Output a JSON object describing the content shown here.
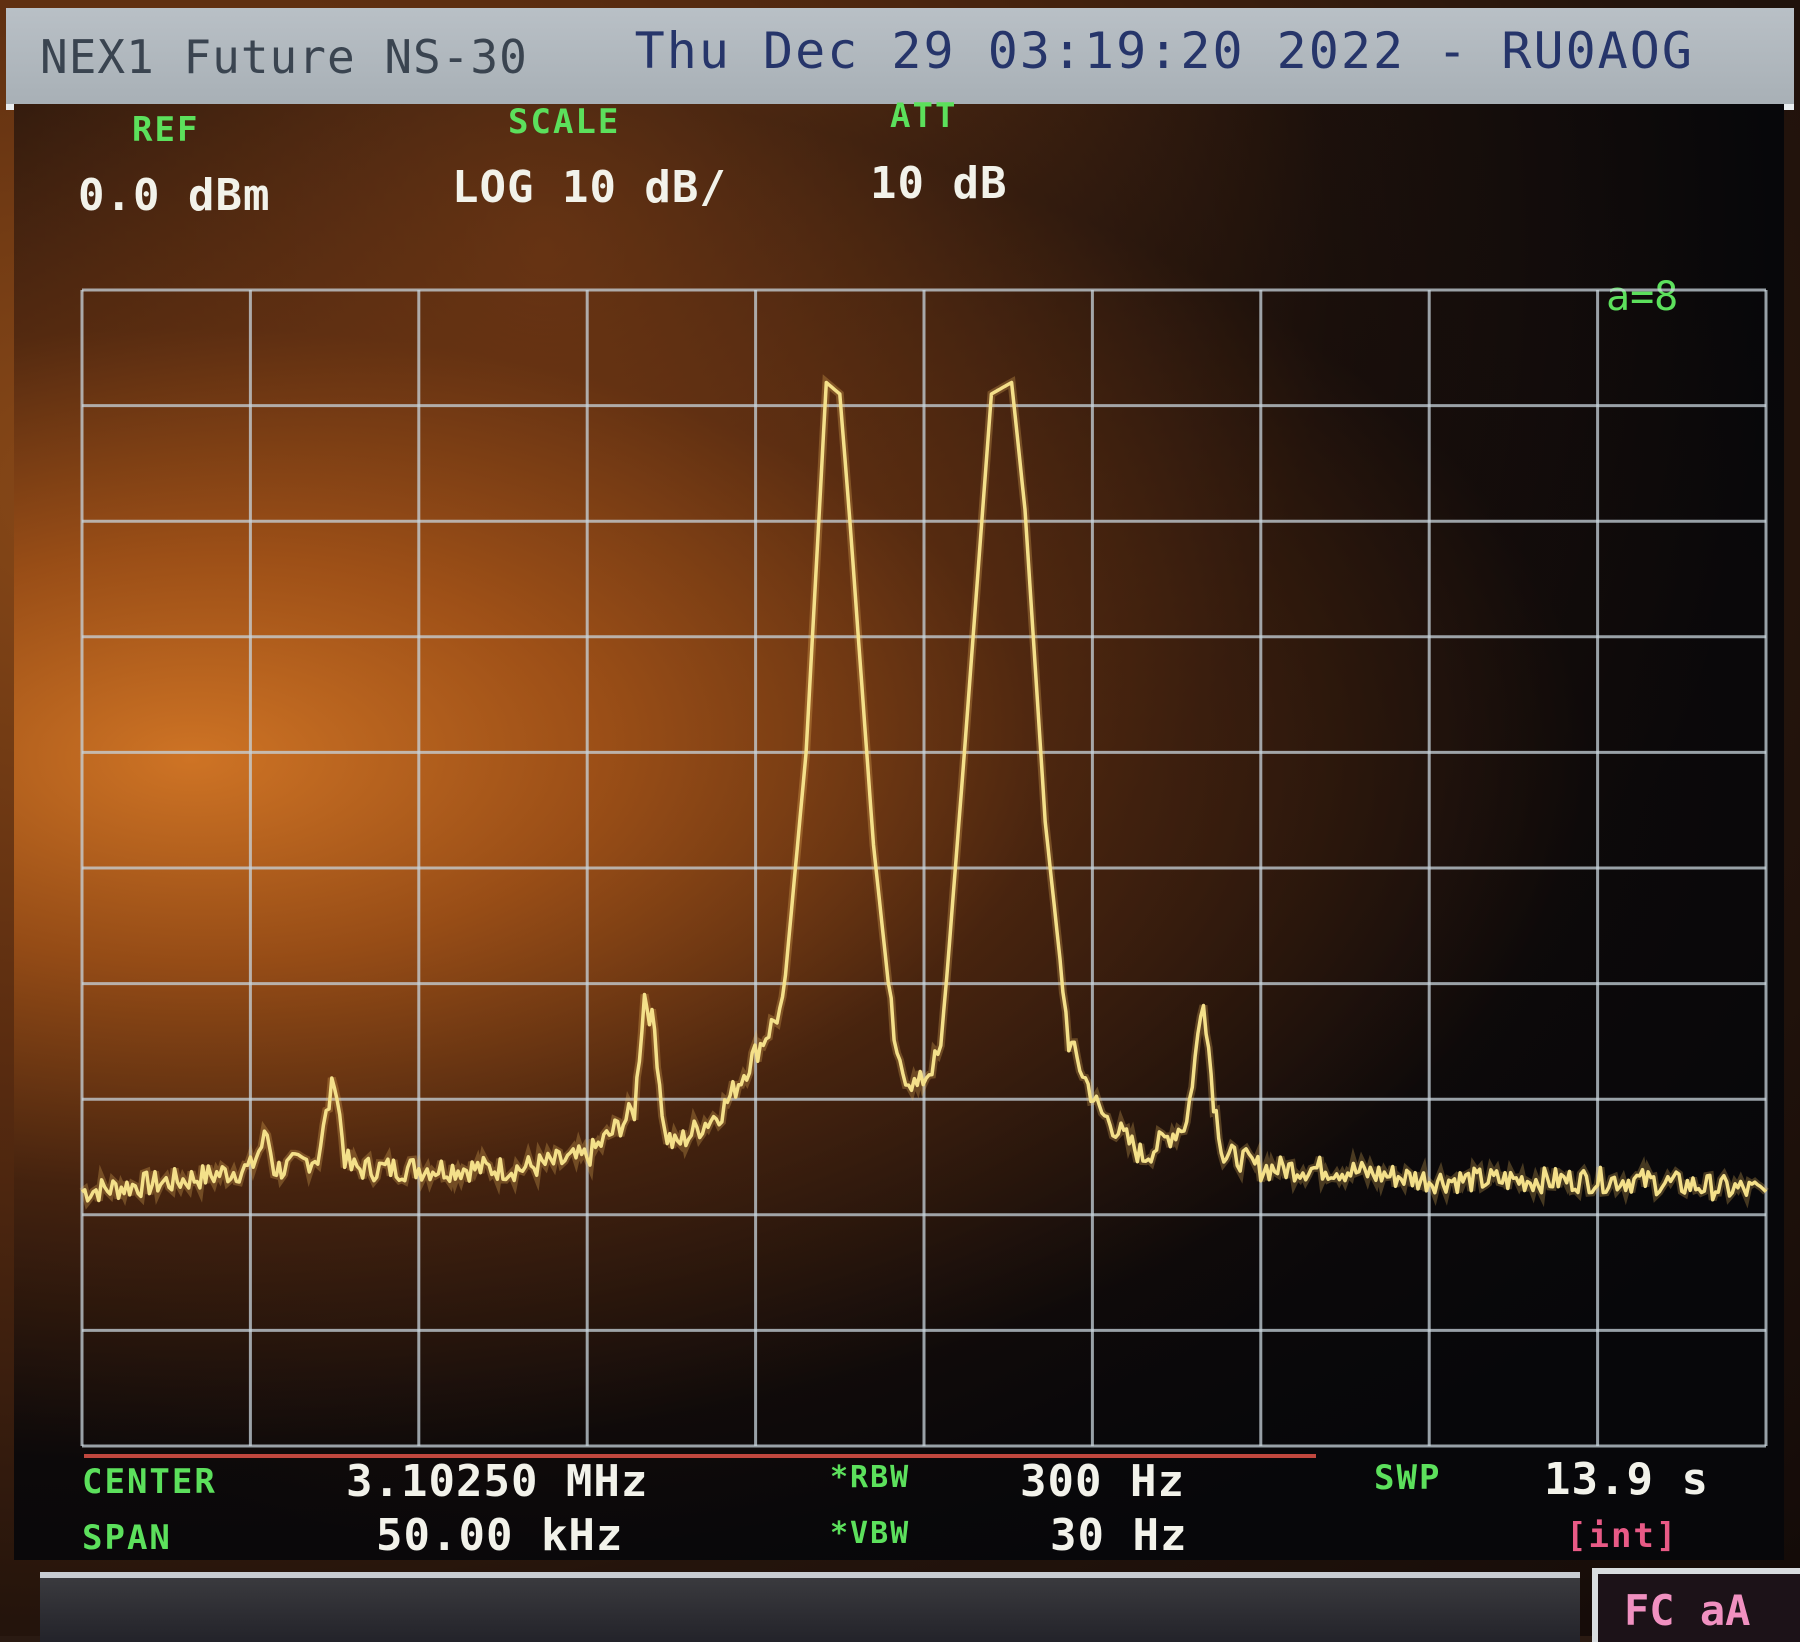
{
  "window": {
    "instrument_title": "NEX1 Future NS-30",
    "status_text": "Thu Dec 29 03:19:20 2022 - RU0AOG"
  },
  "header": {
    "ref_label": "REF",
    "ref_value": "0.0 dBm",
    "scale_label": "SCALE",
    "scale_value": "LOG 10 dB/",
    "att_label": "ATT",
    "att_value": "10 dB"
  },
  "marker": {
    "readout": "a=8"
  },
  "footer": {
    "center_label": "CENTER",
    "center_value": "3.10250 MHz",
    "span_label": "SPAN",
    "span_value": "50.00 kHz",
    "rbw_label": "*RBW",
    "rbw_value": "300 Hz",
    "vbw_label": "*VBW",
    "vbw_value": "30 Hz",
    "swp_label": "SWP",
    "swp_value": "13.9 s",
    "swp_mode": "[int]"
  },
  "softkey": {
    "label": "FC aA"
  },
  "colors": {
    "trace": "#f4e08a",
    "grid": "#c8d4dc",
    "label_green": "#5ce05c",
    "value_white": "#f2f2ea"
  },
  "chart_data": {
    "type": "line",
    "title": "",
    "xlabel": "",
    "ylabel": "",
    "x_unit": "kHz",
    "y_unit": "dBm",
    "xlim": [
      -25,
      25
    ],
    "ylim": [
      -100,
      0
    ],
    "grid": true,
    "series": [
      {
        "values_x": [
          -25,
          -22,
          -20,
          -19.5,
          -19.3,
          -19,
          -18,
          -17.5,
          -17.2,
          -17,
          -16.5,
          -14,
          -12,
          -10,
          -8.6,
          -8.3,
          -8.0,
          -7.7,
          -7.4,
          -6,
          -4.2,
          -3.5,
          -2.9,
          -2.5,
          -2.2,
          -1.5,
          -0.8,
          -0.2,
          0.5,
          1.2,
          2.0,
          2.6,
          3.0,
          3.6,
          4.3,
          5.2,
          6.5,
          7.8,
          8.3,
          8.6,
          8.9,
          9.3,
          10,
          12,
          15,
          18,
          21,
          25
        ],
        "values_y": [
          -78,
          -77,
          -76,
          -73,
          -76,
          -76,
          -75,
          -68,
          -75,
          -76,
          -76,
          -76,
          -76,
          -75,
          -71,
          -61,
          -64,
          -73,
          -74,
          -71,
          -62,
          -40,
          -8,
          -9,
          -20,
          -48,
          -67,
          -69,
          -66,
          -40,
          -9,
          -8,
          -19,
          -46,
          -65,
          -71,
          -75,
          -72,
          -61,
          -70,
          -75,
          -75,
          -76,
          -76,
          -77,
          -77,
          -77,
          -78
        ]
      }
    ]
  }
}
